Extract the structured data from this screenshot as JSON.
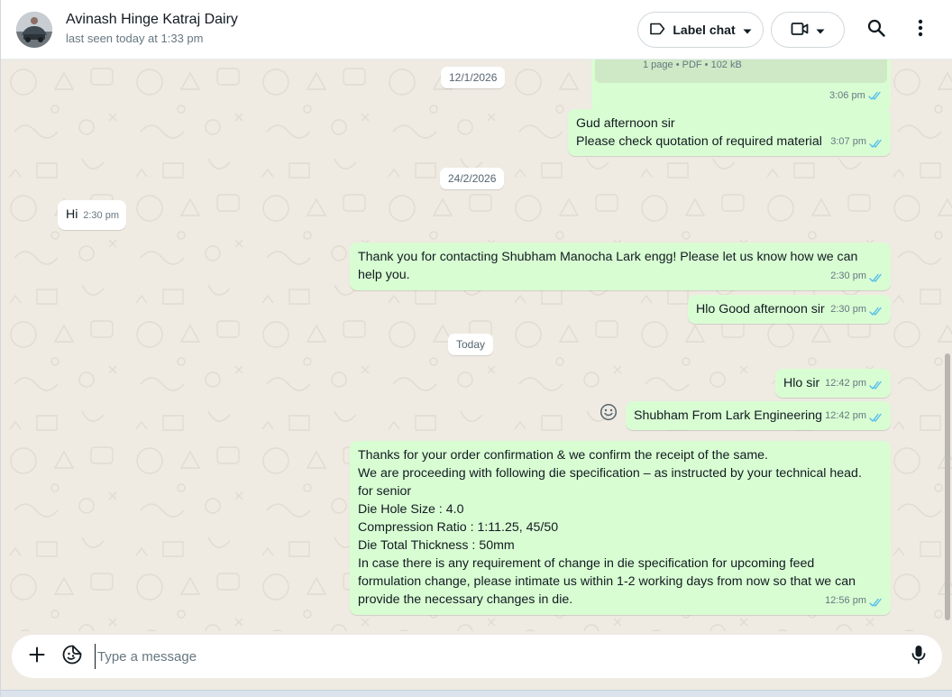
{
  "header": {
    "contact_name": "Avinash Hinge Katraj Dairy",
    "last_seen": "last seen today at 1:33 pm",
    "label_chat": "Label chat"
  },
  "chat": {
    "document": {
      "info": "1 page • PDF • 102 kB",
      "time": "3:06 pm"
    },
    "dates": [
      "12/1/2026",
      "24/2/2026",
      "Today"
    ],
    "messages": [
      {
        "direction": "out",
        "lines": [
          "Gud afternoon sir",
          "Please check quotation of required material"
        ],
        "time": "3:07 pm"
      },
      {
        "direction": "in",
        "lines": [
          "Hi"
        ],
        "time": "2:30 pm"
      },
      {
        "direction": "out",
        "lines": [
          "Thank you for contacting Shubham Manocha Lark engg! Please let us know how we can",
          "help you."
        ],
        "time": "2:30 pm"
      },
      {
        "direction": "out",
        "lines": [
          "Hlo Good afternoon sir"
        ],
        "time": "2:30 pm"
      },
      {
        "direction": "out",
        "lines": [
          "Hlo sir"
        ],
        "time": "12:42 pm"
      },
      {
        "direction": "out",
        "lines": [
          "Shubham From Lark Engineering"
        ],
        "time": "12:42 pm"
      },
      {
        "direction": "out",
        "lines": [
          "Thanks for your order confirmation & we confirm the receipt of the same.",
          "We are proceeding with following die specification –  as instructed by your technical head.",
          "for senior",
          "Die Hole Size : 4.0",
          "Compression Ratio : 1:11.25, 45/50",
          "Die Total Thickness : 50mm",
          "In case there is any requirement of change in die specification for upcoming feed",
          "formulation change, please intimate us within 1-2 working days from now so that we can",
          "provide the necessary changes in die."
        ],
        "time": "12:56 pm"
      }
    ]
  },
  "composer": {
    "placeholder": "Type a message"
  },
  "colors": {
    "outgoing": "#d9fdd3",
    "incoming": "#ffffff",
    "read_ticks": "#53bdeb",
    "background": "#efeae2"
  },
  "icons": [
    "label-icon",
    "chevron-down-icon",
    "video-icon",
    "search-icon",
    "menu-dots-icon",
    "plus-icon",
    "sticker-icon",
    "mic-icon",
    "emoji-icon",
    "double-tick-icon"
  ]
}
